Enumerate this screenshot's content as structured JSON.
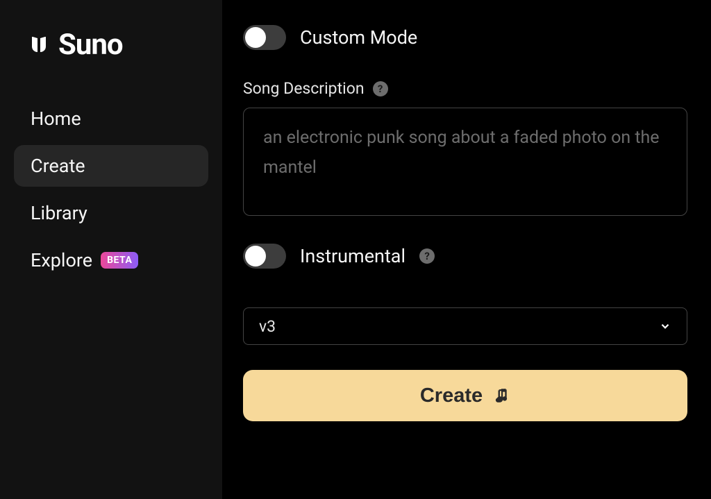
{
  "logo": {
    "text": "Suno"
  },
  "sidebar": {
    "items": [
      {
        "label": "Home",
        "active": false
      },
      {
        "label": "Create",
        "active": true
      },
      {
        "label": "Library",
        "active": false
      },
      {
        "label": "Explore",
        "active": false,
        "badge": "BETA"
      }
    ]
  },
  "main": {
    "custom_mode_label": "Custom Mode",
    "custom_mode_on": false,
    "description_label": "Song Description",
    "description_placeholder": "an electronic punk song about a faded photo on the mantel",
    "description_value": "",
    "instrumental_label": "Instrumental",
    "instrumental_on": false,
    "version_selected": "v3",
    "create_button_label": "Create"
  }
}
